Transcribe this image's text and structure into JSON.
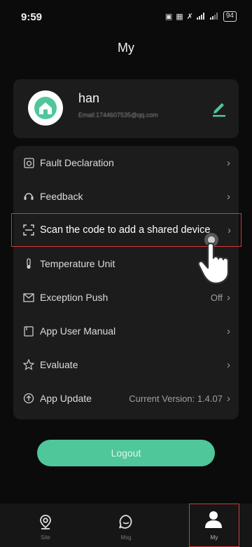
{
  "status_bar": {
    "time": "9:59",
    "battery": "94"
  },
  "header": {
    "title": "My"
  },
  "profile": {
    "username": "han",
    "email": "Email:1744607535@qq.com"
  },
  "menu": {
    "items": [
      {
        "label": "Fault Declaration",
        "value": "",
        "icon": "fault-declaration-icon"
      },
      {
        "label": "Feedback",
        "value": "",
        "icon": "feedback-icon"
      },
      {
        "label": "Scan the code to add a shared device",
        "value": "",
        "icon": "scan-icon"
      },
      {
        "label": "Temperature Unit",
        "value": "",
        "icon": "thermometer-icon"
      },
      {
        "label": "Exception Push",
        "value": "Off",
        "icon": "mail-icon"
      },
      {
        "label": "App User Manual",
        "value": "",
        "icon": "manual-icon"
      },
      {
        "label": "Evaluate",
        "value": "",
        "icon": "star-icon"
      },
      {
        "label": "App Update",
        "value": "Current Version: 1.4.07",
        "icon": "upload-icon"
      }
    ]
  },
  "logout_label": "Logout",
  "tabs": [
    {
      "label": "Site",
      "icon": "location-pin-icon"
    },
    {
      "label": "Msg",
      "icon": "chat-bubble-icon"
    },
    {
      "label": "My",
      "icon": "user-icon"
    }
  ],
  "colors": {
    "accent": "#4fc79a",
    "highlight_border": "#d23a3a",
    "card_bg": "#1c1c1c"
  }
}
